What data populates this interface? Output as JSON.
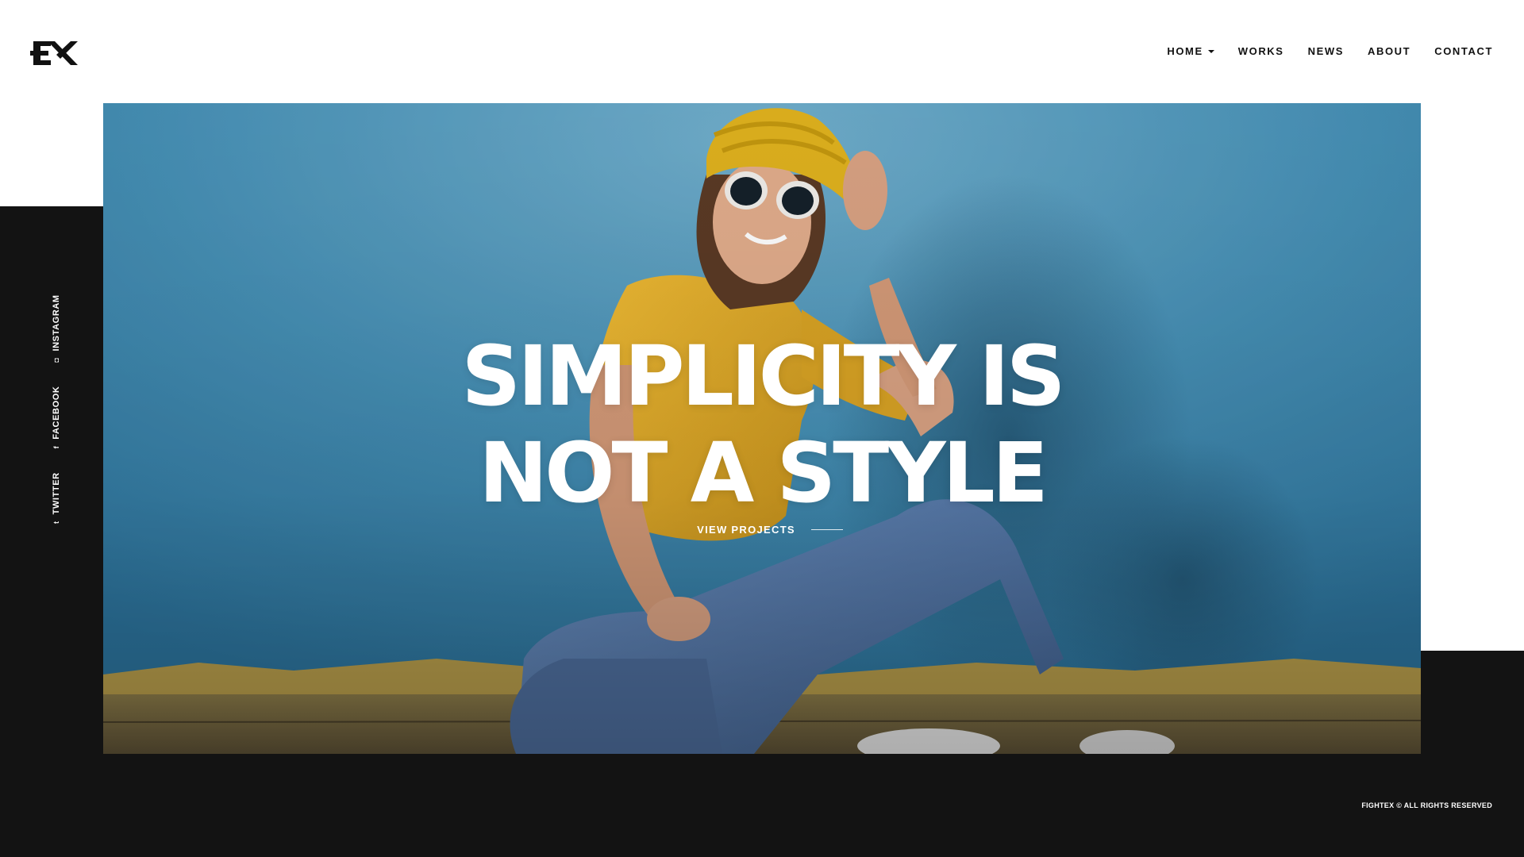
{
  "brand": {
    "logo_text": "EX"
  },
  "nav": {
    "items": [
      {
        "label": "HOME",
        "has_dropdown": true
      },
      {
        "label": "WORKS"
      },
      {
        "label": "NEWS"
      },
      {
        "label": "ABOUT"
      },
      {
        "label": "CONTACT"
      }
    ]
  },
  "hero": {
    "headline_line1": "SIMPLICITY IS",
    "headline_line2": "NOT A STYLE",
    "cta_label": "VIEW PROJECTS"
  },
  "social": {
    "items": [
      {
        "label": "TWITTER",
        "icon": "twitter-icon",
        "glyph": "t"
      },
      {
        "label": "FACEBOOK",
        "icon": "facebook-icon",
        "glyph": "f"
      },
      {
        "label": "INSTAGRAM",
        "icon": "instagram-icon",
        "glyph": "◘"
      }
    ]
  },
  "footer": {
    "copyright": "FIGHTEX © ALL RIGHTS RESERVED"
  },
  "colors": {
    "dark": "#131313",
    "background": "#ffffff",
    "wall_blue": "#4d9bc0",
    "shirt_yellow": "#e3ad2c",
    "jeans_blue": "#5a7fb0"
  }
}
